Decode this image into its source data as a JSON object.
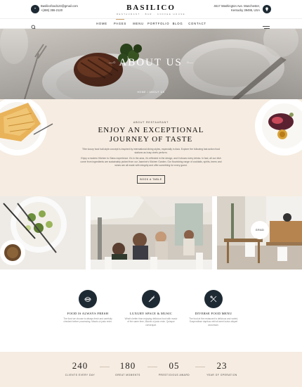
{
  "header": {
    "email": "Basilicofood123@gmail.com",
    "phone": "+(486) 355-2120",
    "logo_name": "BASILICO",
    "logo_tagline": "RESTAURANT · BAR · COFFEE HOUSE",
    "address_line1": "4617 Washington Ave. Manchester,",
    "address_line2": "Kentucky 39495, USA"
  },
  "nav": {
    "items": [
      "HOME",
      "PAGES",
      "MENU",
      "PORTFOLIO",
      "BLOG",
      "CONTACT"
    ],
    "active": "PAGES"
  },
  "hero": {
    "title": "ABOUT US",
    "breadcrumb": "HOME / ABOUT US"
  },
  "about": {
    "kicker": "ABOUT RESTAURANT",
    "heading_line1": "ENJOY AN EXCEPTIONAL",
    "heading_line2": "JOURNEY OF TASTE",
    "para1": "Tthe luxury food hall-style concept is inspired by international dining styles, especially in Asia. Explore the following fast action food stations as busy chefs perform.",
    "para2": "Enjoy a modern Kitchen to Glass experience. It's in the area, it's reflected in the design, and it shows every drinks. In fact, all our dish come from ingredients are sustainably picked from our Jasmine's Kitchen Garden. Our flourishing range of cocktails, spirits, beers and wines are all made with integrity and offer something for every guest.",
    "book_label": "BOOK A TABLE"
  },
  "gallery": {
    "label": "GRAD"
  },
  "features": [
    {
      "icon": "burger-bowl-icon",
      "title": "FOOD IS ALWAYS FRESH",
      "text": "The food we choose is always fresh and carefully checked before processing. Mauris ut justo enim."
    },
    {
      "icon": "carrot-icon",
      "title": "LUXURY SPACE & MUSIC",
      "text": "What's better than enjoying delicious food with music of the same time, Mauris ut justo enim. Quisque consequat."
    },
    {
      "icon": "fork-knife-icon",
      "title": "DIVERSE FOOD MENU",
      "text": "The food at the restaurant is delicious and varied, Suspendisse dapibus velit sit amet luctus aliquet accumsan."
    }
  ],
  "stats": [
    {
      "number": "240",
      "label": "CLIENTS EVERY DAY"
    },
    {
      "number": "180",
      "label": "GREAT MOMENTS"
    },
    {
      "number": "05",
      "label": "PRESTIGIOUS AWARD"
    },
    {
      "number": "23",
      "label": "YEAR OF OPERATION"
    }
  ],
  "colors": {
    "accent": "#c9a06b",
    "dark": "#1e2a33",
    "cream": "#f6ece1"
  }
}
